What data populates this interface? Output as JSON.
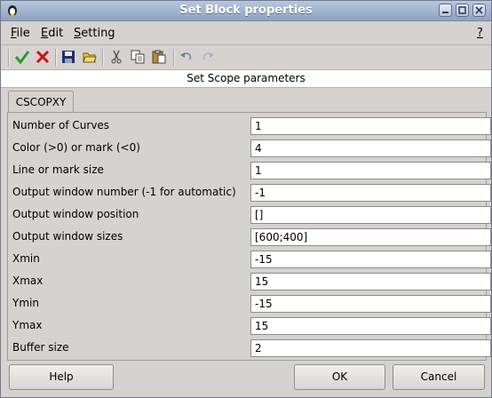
{
  "window": {
    "title": "Set Block properties"
  },
  "menu": [
    {
      "label": "File",
      "accel": "F",
      "rest": "ile"
    },
    {
      "label": "Edit",
      "accel": "E",
      "rest": "dit"
    },
    {
      "label": "Setting",
      "accel": "S",
      "rest": "etting"
    }
  ],
  "menu_help": "?",
  "toolbar_icons": [
    "ok-check-icon",
    "cancel-x-icon",
    "save-icon",
    "open-folder-icon",
    "cut-icon",
    "copy-icon",
    "paste-icon",
    "undo-icon",
    "redo-icon"
  ],
  "panel_title": "Set Scope parameters",
  "tab": {
    "label": "CSCOPXY"
  },
  "fields": [
    {
      "label": "Number of Curves",
      "value": "1"
    },
    {
      "label": "Color (>0) or mark (<0)",
      "value": "4"
    },
    {
      "label": "Line or mark size",
      "value": "1"
    },
    {
      "label": "Output window number (-1 for automatic)",
      "value": "-1"
    },
    {
      "label": "Output window position",
      "value": "[]"
    },
    {
      "label": "Output window sizes",
      "value": "[600;400]"
    },
    {
      "label": "Xmin",
      "value": "-15"
    },
    {
      "label": "Xmax",
      "value": "15"
    },
    {
      "label": "Ymin",
      "value": "-15"
    },
    {
      "label": "Ymax",
      "value": "15"
    },
    {
      "label": "Buffer size",
      "value": "2"
    }
  ],
  "buttons": {
    "help": "Help",
    "ok": "OK",
    "cancel": "Cancel"
  },
  "colors": {
    "titlebar": "#8ea3c2",
    "background": "#d6d2d0",
    "ok_check": "#2e9a2e",
    "cancel_x": "#d01010"
  }
}
